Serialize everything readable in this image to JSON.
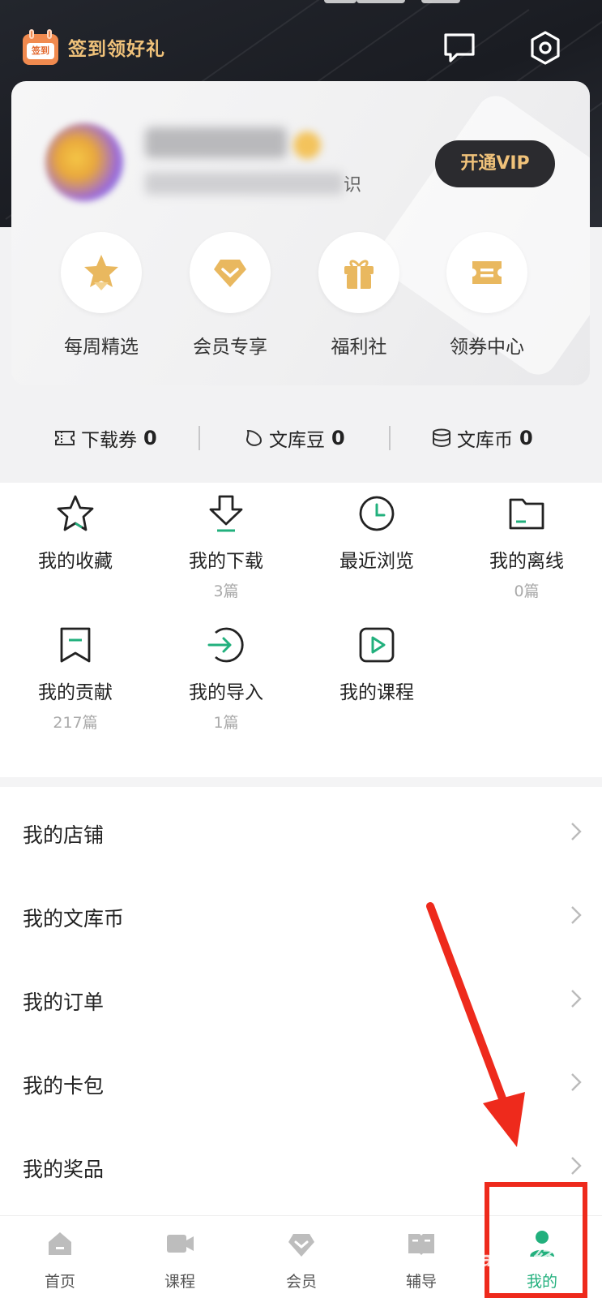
{
  "header": {
    "checkin_label": "签到领好礼",
    "checkin_icon_text": "签到"
  },
  "profile": {
    "desc_tail": "识",
    "vip_button": "开通VIP"
  },
  "perks": [
    {
      "label": "每周精选",
      "icon": "star-badge-icon"
    },
    {
      "label": "会员专享",
      "icon": "heart-diamond-icon"
    },
    {
      "label": "福利社",
      "icon": "gift-icon"
    },
    {
      "label": "领券中心",
      "icon": "coupon-icon"
    }
  ],
  "assets": [
    {
      "label": "下载券",
      "value": "0",
      "icon": "ticket-icon"
    },
    {
      "label": "文库豆",
      "value": "0",
      "icon": "bean-icon"
    },
    {
      "label": "文库币",
      "value": "0",
      "icon": "coin-stack-icon"
    }
  ],
  "features": [
    {
      "label": "我的收藏",
      "sub": "",
      "icon": "star-icon"
    },
    {
      "label": "我的下载",
      "sub": "3篇",
      "icon": "download-icon"
    },
    {
      "label": "最近浏览",
      "sub": "",
      "icon": "clock-icon"
    },
    {
      "label": "我的离线",
      "sub": "0篇",
      "icon": "folder-icon"
    },
    {
      "label": "我的贡献",
      "sub": "217篇",
      "icon": "bookmark-icon"
    },
    {
      "label": "我的导入",
      "sub": "1篇",
      "icon": "import-icon"
    },
    {
      "label": "我的课程",
      "sub": "",
      "icon": "play-icon"
    }
  ],
  "menu": [
    {
      "label": "我的店铺"
    },
    {
      "label": "我的文库币"
    },
    {
      "label": "我的订单"
    },
    {
      "label": "我的卡包"
    },
    {
      "label": "我的奖品"
    }
  ],
  "tabs": [
    {
      "label": "首页",
      "icon": "home-icon"
    },
    {
      "label": "课程",
      "icon": "video-icon"
    },
    {
      "label": "会员",
      "icon": "member-icon"
    },
    {
      "label": "辅导",
      "icon": "book-icon"
    },
    {
      "label": "我的",
      "icon": "user-icon",
      "active": true
    }
  ],
  "colors": {
    "accent_green": "#22b07d",
    "gold": "#f0c27a",
    "annotation_red": "#ee2a1c"
  },
  "watermark": "Baidu经验"
}
